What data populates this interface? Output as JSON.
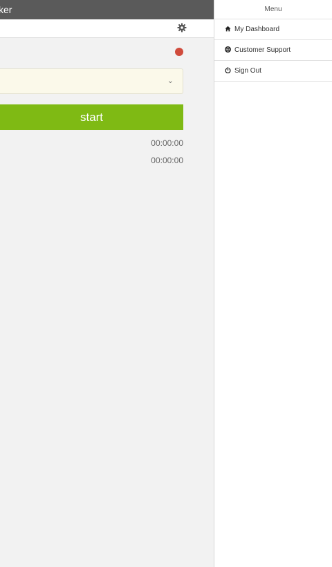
{
  "app": {
    "title": "ker"
  },
  "tracker": {
    "start_label": "start",
    "time_1": "00:00:00",
    "time_2": "00:00:00",
    "status_color": "#d04b3c",
    "accent_color": "#7fba14"
  },
  "menu": {
    "title": "Menu",
    "items": [
      {
        "label": "My Dashboard",
        "icon": "home-icon"
      },
      {
        "label": "Customer Support",
        "icon": "life-ring-icon"
      },
      {
        "label": "Sign Out",
        "icon": "power-icon"
      }
    ]
  }
}
